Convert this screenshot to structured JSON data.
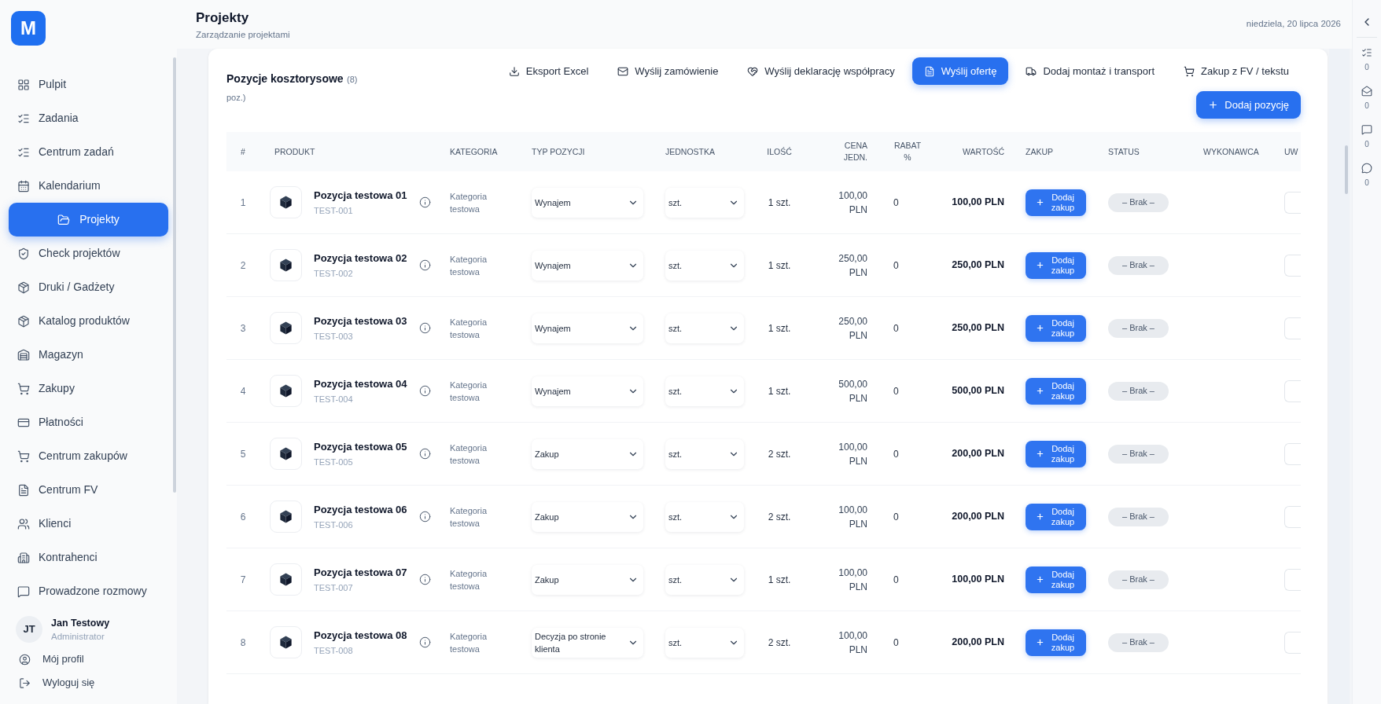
{
  "sidebar": {
    "logo": "M",
    "items": [
      {
        "label": "Pulpit",
        "selected": false
      },
      {
        "label": "Zadania",
        "selected": false
      },
      {
        "label": "Centrum zadań",
        "selected": false
      },
      {
        "label": "Kalendarium",
        "selected": false
      },
      {
        "label": "Projekty",
        "selected": true
      },
      {
        "label": "Check projektów",
        "selected": false
      },
      {
        "label": "Druki / Gadżety",
        "selected": false
      },
      {
        "label": "Katalog produktów",
        "selected": false
      },
      {
        "label": "Magazyn",
        "selected": false
      },
      {
        "label": "Zakupy",
        "selected": false
      },
      {
        "label": "Płatności",
        "selected": false
      },
      {
        "label": "Centrum zakupów",
        "selected": false
      },
      {
        "label": "Centrum FV",
        "selected": false
      },
      {
        "label": "Klienci",
        "selected": false
      },
      {
        "label": "Kontrahenci",
        "selected": false
      },
      {
        "label": "Prowadzone rozmowy",
        "selected": false
      }
    ],
    "user": {
      "initials": "JT",
      "name": "Jan Testowy",
      "role": "Administrator"
    },
    "links": [
      "Mój profil",
      "Wyloguj się"
    ]
  },
  "header": {
    "title": "Projekty",
    "subtitle": "Zarządzanie projektami",
    "date": "niedziela, 20 lipca 2026"
  },
  "section": {
    "title": "Pozycje kosztorysowe",
    "count": "(8) poz.)",
    "actions": [
      {
        "label": "Eksport Excel",
        "selected": false
      },
      {
        "label": "Wyślij zamówienie",
        "selected": false
      },
      {
        "label": "Wyślij deklarację współpracy",
        "selected": false
      },
      {
        "label": "Wyślij ofertę",
        "selected": true
      },
      {
        "label": "Dodaj montaż i transport",
        "selected": false
      },
      {
        "label": "Zakup z FV / tekstu",
        "selected": false
      }
    ],
    "add_button": "Dodaj pozycję"
  },
  "table": {
    "columns": [
      "#",
      "PRODUKT",
      "KATEGORIA",
      "TYP POZYCJI",
      "JEDNOSTKA",
      "ILOŚĆ",
      "CENA JEDN.",
      "RABAT %",
      "WARTOŚĆ",
      "ZAKUP",
      "STATUS",
      "WYKONAWCA",
      "UW"
    ],
    "rows": [
      {
        "number": "1",
        "name": "Pozycja testowa 01",
        "code": "TEST-001",
        "category": "Kategoria testowa",
        "type": "Wynajem",
        "unit": "szt.",
        "quantity": "1 szt.",
        "price": "100,00 PLN",
        "discount": "0",
        "value": "100,00 PLN",
        "purchase_button": "Dodaj zakup",
        "status": "– Brak –"
      },
      {
        "number": "2",
        "name": "Pozycja testowa 02",
        "code": "TEST-002",
        "category": "Kategoria testowa",
        "type": "Wynajem",
        "unit": "szt.",
        "quantity": "1 szt.",
        "price": "250,00 PLN",
        "discount": "0",
        "value": "250,00 PLN",
        "purchase_button": "Dodaj zakup",
        "status": "– Brak –"
      },
      {
        "number": "3",
        "name": "Pozycja testowa 03",
        "code": "TEST-003",
        "category": "Kategoria testowa",
        "type": "Wynajem",
        "unit": "szt.",
        "quantity": "1 szt.",
        "price": "250,00 PLN",
        "discount": "0",
        "value": "250,00 PLN",
        "purchase_button": "Dodaj zakup",
        "status": "– Brak –"
      },
      {
        "number": "4",
        "name": "Pozycja testowa 04",
        "code": "TEST-004",
        "category": "Kategoria testowa",
        "type": "Wynajem",
        "unit": "szt.",
        "quantity": "1 szt.",
        "price": "500,00 PLN",
        "discount": "0",
        "value": "500,00 PLN",
        "purchase_button": "Dodaj zakup",
        "status": "– Brak –"
      },
      {
        "number": "5",
        "name": "Pozycja testowa 05",
        "code": "TEST-005",
        "category": "Kategoria testowa",
        "type": "Zakup",
        "unit": "szt.",
        "quantity": "2 szt.",
        "price": "100,00 PLN",
        "discount": "0",
        "value": "200,00 PLN",
        "purchase_button": "Dodaj zakup",
        "status": "– Brak –"
      },
      {
        "number": "6",
        "name": "Pozycja testowa 06",
        "code": "TEST-006",
        "category": "Kategoria testowa",
        "type": "Zakup",
        "unit": "szt.",
        "quantity": "2 szt.",
        "price": "100,00 PLN",
        "discount": "0",
        "value": "200,00 PLN",
        "purchase_button": "Dodaj zakup",
        "status": "– Brak –"
      },
      {
        "number": "7",
        "name": "Pozycja testowa 07",
        "code": "TEST-007",
        "category": "Kategoria testowa",
        "type": "Zakup",
        "unit": "szt.",
        "quantity": "1 szt.",
        "price": "100,00 PLN",
        "discount": "0",
        "value": "100,00 PLN",
        "purchase_button": "Dodaj zakup",
        "status": "– Brak –"
      },
      {
        "number": "8",
        "name": "Pozycja testowa 08",
        "code": "TEST-008",
        "category": "Kategoria testowa",
        "type": "Decyzja po stronie klienta",
        "unit": "szt.",
        "quantity": "2 szt.",
        "price": "100,00 PLN",
        "discount": "0",
        "value": "200,00 PLN",
        "purchase_button": "Dodaj zakup",
        "status": "– Brak –"
      }
    ]
  },
  "right_panel": {
    "counters": [
      "0",
      "0",
      "0",
      "0"
    ]
  }
}
